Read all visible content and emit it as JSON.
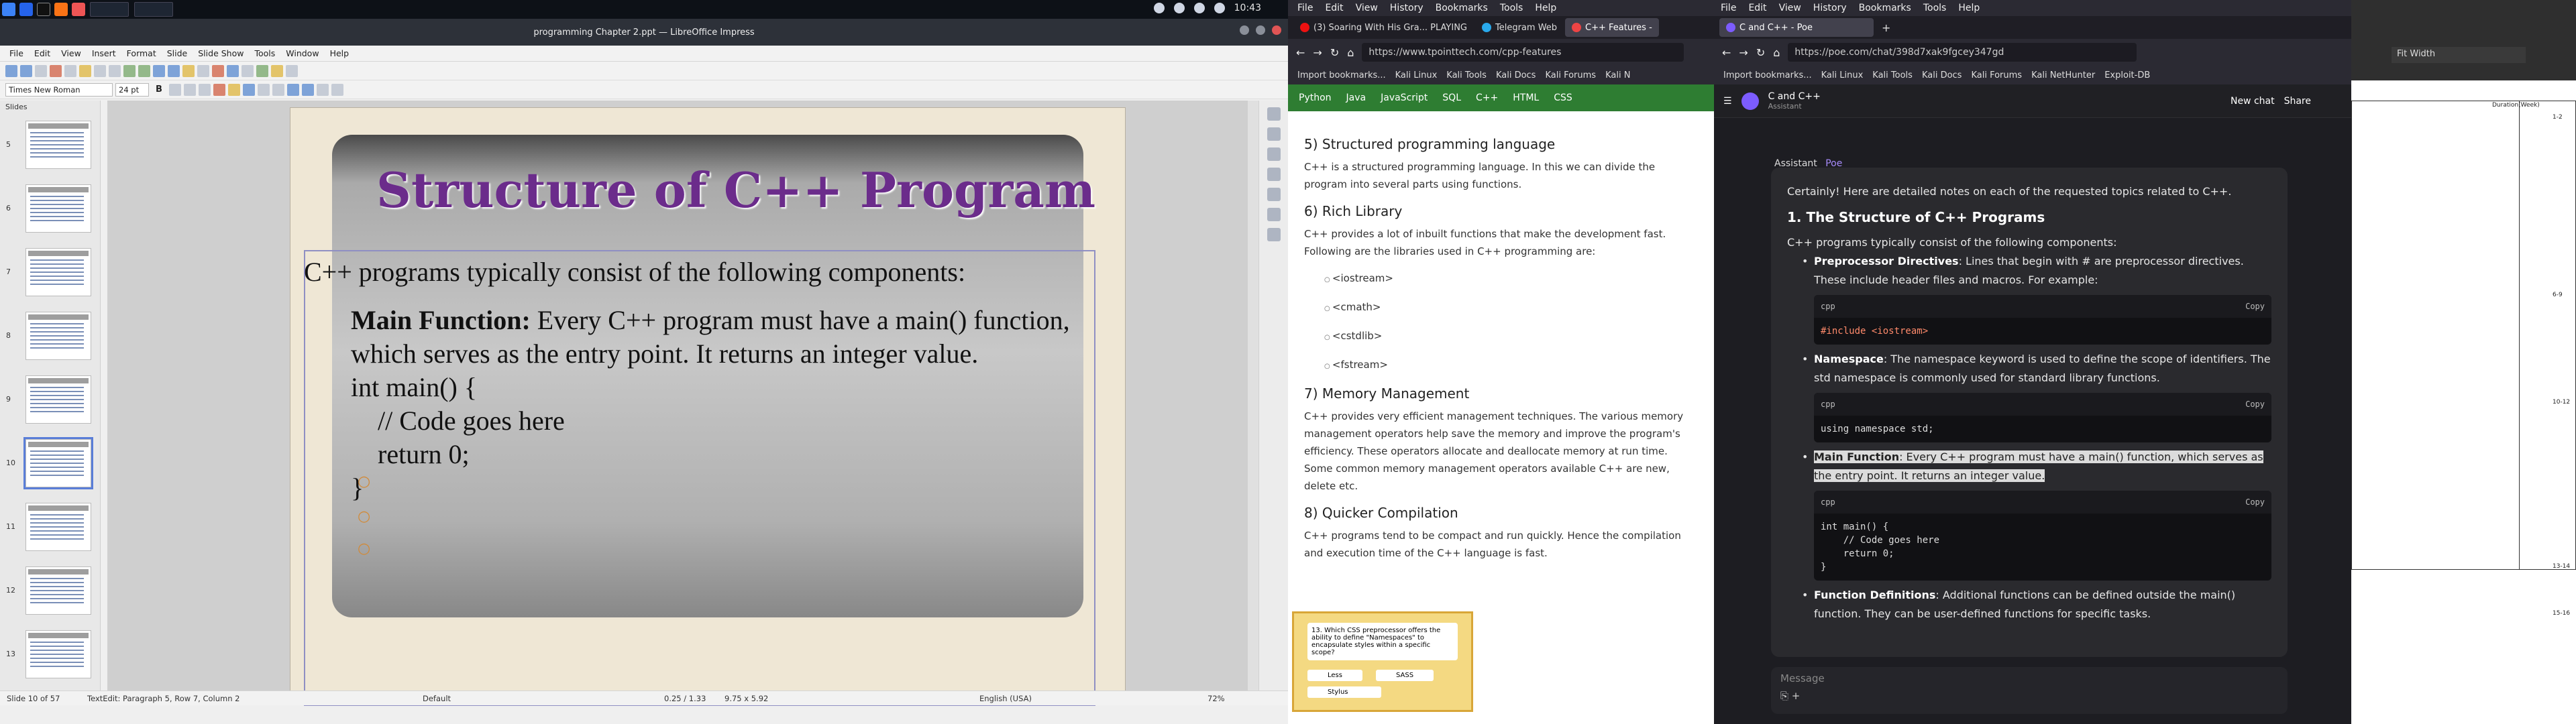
{
  "taskbar": {
    "clock": "10:43"
  },
  "libreoffice": {
    "window_title": "programming Chapter 2.ppt — LibreOffice Impress",
    "menu": [
      "File",
      "Edit",
      "View",
      "Insert",
      "Format",
      "Slide",
      "Slide Show",
      "Tools",
      "Window",
      "Help"
    ],
    "font_name": "Times New Roman",
    "font_size": "24 pt",
    "slides_label": "Slides",
    "slide_numbers": [
      "5",
      "6",
      "7",
      "8",
      "9",
      "10",
      "11",
      "12",
      "13"
    ],
    "slide": {
      "title": "Structure of C++ Program",
      "intro": "C++ programs typically consist of the following components:",
      "main_fn_bold": "Main Function:",
      "main_fn_text": " Every C++ program must have a main() function, which serves as the entry point. It returns an integer value.",
      "code1": "int main() {",
      "code2": "// Code goes here",
      "code3": "return 0;",
      "code4": "}"
    },
    "status": {
      "slide": "Slide 10 of 57",
      "edit": "TextEdit: Paragraph 5, Row 7, Column 2",
      "layout": "Default",
      "pos": "0.25 / 1.33",
      "size": "9.75 x 5.92",
      "lang": "English (USA)",
      "zoom": "72%"
    }
  },
  "firefox1": {
    "menu": [
      "File",
      "Edit",
      "View",
      "History",
      "Bookmarks",
      "Tools",
      "Help"
    ],
    "tabs": [
      "(3) Soaring With His Gra... PLAYING",
      "Telegram Web",
      "C++ Features -"
    ],
    "url": "https://www.tpointtech.com/cpp-features",
    "bookmarks": [
      "Import bookmarks...",
      "Kali Linux",
      "Kali Tools",
      "Kali Docs",
      "Kali Forums",
      "Kali N"
    ],
    "green_nav": [
      "Python",
      "Java",
      "JavaScript",
      "SQL",
      "C++",
      "HTML",
      "CSS"
    ],
    "sections": [
      {
        "h": "5) Structured programming language",
        "p": "C++ is a structured programming language. In this we can divide the program into several parts using functions."
      },
      {
        "h": "6) Rich Library",
        "p": "C++ provides a lot of inbuilt functions that make the development fast. Following are the libraries used in C++ programming are:"
      },
      {
        "h": "7) Memory Management",
        "p": "C++ provides very efficient management techniques. The various memory management operators help save the memory and improve the program's efficiency. These operators allocate and deallocate memory at run time. Some common memory management operators available C++ are new, delete etc."
      },
      {
        "h": "8) Quicker Compilation",
        "p": "C++ programs tend to be compact and run quickly. Hence the compilation and execution time of the C++ language is fast."
      }
    ],
    "libs": [
      "<iostream>",
      "<cmath>",
      "<cstdlib>",
      "<fstream>"
    ],
    "quiz": {
      "q": "13. Which CSS preprocessor offers the ability to define \"Namespaces\" to encapsulate styles within a specific scope?",
      "a": "Less",
      "b": "SASS",
      "c": "Stylus"
    }
  },
  "firefox2": {
    "menu": [
      "File",
      "Edit",
      "View",
      "History",
      "Bookmarks",
      "Tools",
      "Help"
    ],
    "tab": "C and C++ - Poe",
    "url": "https://poe.com/chat/398d7xak9fgcey347gd",
    "bookmarks": [
      "Import bookmarks...",
      "Kali Linux",
      "Kali Tools",
      "Kali Docs",
      "Kali Forums",
      "Kali NetHunter",
      "Exploit-DB"
    ],
    "chat_title": "C and C++",
    "chat_sub": "Assistant",
    "new_chat": "New chat",
    "share": "Share",
    "sender": "Assistant",
    "sender_badge": "Poe",
    "intro": "Certainly! Here are detailed notes on each of the requested topics related to C++.",
    "h1": "1. The Structure of C++ Programs",
    "p1": "C++ programs typically consist of the following components:",
    "pp_b": "Preprocessor Directives",
    "pp_t": ": Lines that begin with # are preprocessor directives. These include header files and macros. For example:",
    "code_lang": "cpp",
    "copy": "Copy",
    "code1": "#include <iostream>",
    "ns_b": "Namespace",
    "ns_t": ": The namespace keyword is used to define the scope of identifiers. The std namespace is commonly used for standard library functions.",
    "code2": "using namespace std;",
    "mf_b": "Main Function",
    "mf_t": ": Every C++ program must have a main() function, which serves as the entry point. It returns an integer value.",
    "code3": "int main() {\n    // Code goes here\n    return 0;\n}",
    "fd_b": "Function Definitions",
    "fd_t": ": Additional functions can be defined outside the main() function. They can be user-defined functions for specific tasks.",
    "msg_placeholder": "Message"
  },
  "rightdoc": {
    "zoom": "Fit Width",
    "col_header": "Duration(Week)",
    "rows": [
      "1-2",
      "6-9",
      "10-12",
      "13-14",
      "15-16"
    ]
  }
}
